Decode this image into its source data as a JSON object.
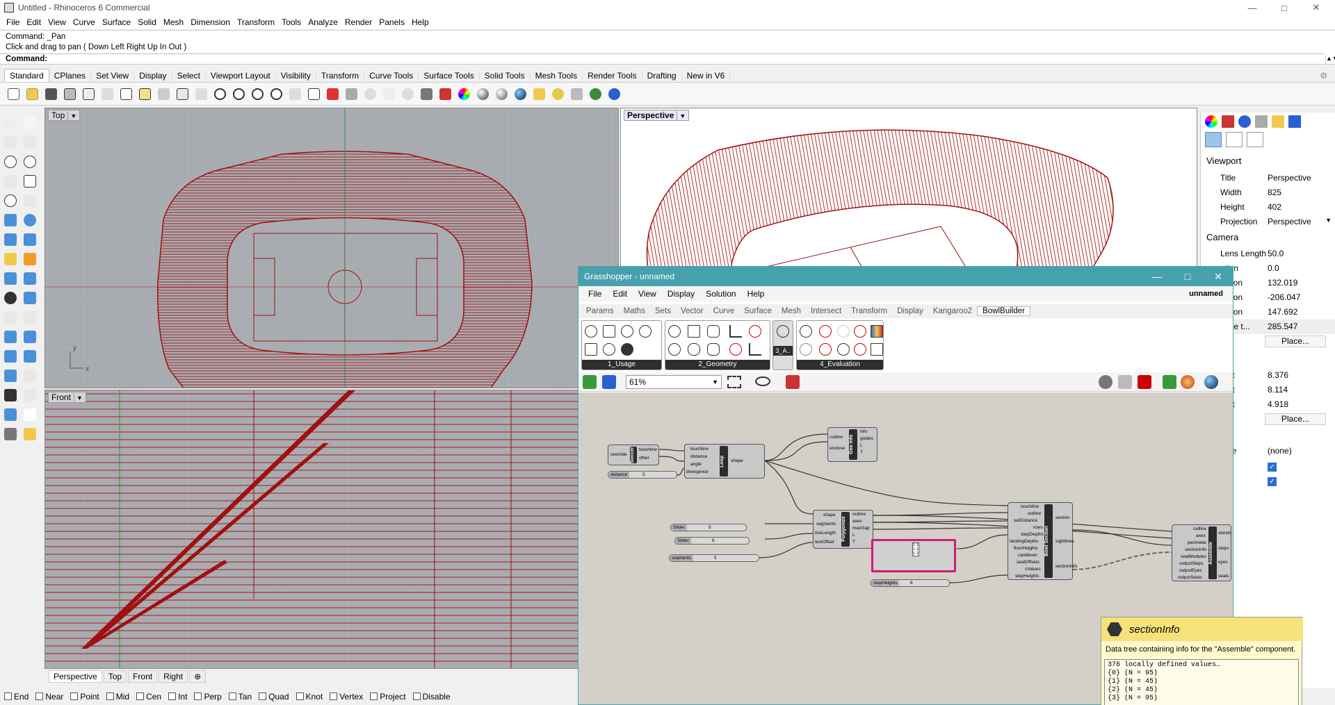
{
  "window": {
    "title": "Untitled - Rhinoceros 6 Commercial"
  },
  "menu": [
    "File",
    "Edit",
    "View",
    "Curve",
    "Surface",
    "Solid",
    "Mesh",
    "Dimension",
    "Transform",
    "Tools",
    "Analyze",
    "Render",
    "Panels",
    "Help"
  ],
  "command": {
    "line1": "Command: _Pan",
    "line2": "Click and drag to pan ( Down  Left  Right  Up  In  Out )",
    "prompt": "Command:"
  },
  "toolbar_tabs": [
    "Standard",
    "CPlanes",
    "Set View",
    "Display",
    "Select",
    "Viewport Layout",
    "Visibility",
    "Transform",
    "Curve Tools",
    "Surface Tools",
    "Solid Tools",
    "Mesh Tools",
    "Render Tools",
    "Drafting",
    "New in V6"
  ],
  "viewports": {
    "top": "Top",
    "perspective": "Perspective",
    "front": "Front"
  },
  "axis": {
    "y": "y",
    "x": "x"
  },
  "viewport_tabs": [
    "Perspective",
    "Top",
    "Front",
    "Right"
  ],
  "osnaps": [
    "End",
    "Near",
    "Point",
    "Mid",
    "Cen",
    "Int",
    "Perp",
    "Tan",
    "Quad",
    "Knot",
    "Vertex",
    "Project",
    "Disable"
  ],
  "properties": {
    "viewport_head": "Viewport",
    "rows": [
      {
        "k": "Title",
        "v": "Perspective"
      },
      {
        "k": "Width",
        "v": "825"
      },
      {
        "k": "Height",
        "v": "402"
      },
      {
        "k": "Projection",
        "v": "Perspective"
      }
    ],
    "camera_head": "Camera",
    "camera_rows": [
      {
        "k": "Lens Length",
        "v": "50.0"
      },
      {
        "k": "ation",
        "v": "0.0"
      },
      {
        "k": "cation",
        "v": "132.019"
      },
      {
        "k": "cation",
        "v": "-206.047"
      },
      {
        "k": "cation",
        "v": "147.692"
      },
      {
        "k": "ance t...",
        "v": "285.547"
      }
    ],
    "place1": "Place...",
    "target_rows": [
      {
        "k": "rget",
        "v": "8.376"
      },
      {
        "k": "rget",
        "v": "8.114"
      },
      {
        "k": "rget",
        "v": "4.918"
      }
    ],
    "place2": "Place...",
    "wallpaper_head": "per",
    "name_row": {
      "k": "ame",
      "v": "(none)"
    }
  },
  "grasshopper": {
    "title": "Grasshopper - unnamed",
    "menu": [
      "File",
      "Edit",
      "View",
      "Display",
      "Solution",
      "Help"
    ],
    "doc_name": "unnamed",
    "tabs": [
      "Params",
      "Maths",
      "Sets",
      "Vector",
      "Curve",
      "Surface",
      "Mesh",
      "Intersect",
      "Transform",
      "Display",
      "Kangaroo2",
      "BowlBuilder"
    ],
    "groups": [
      "1_Usage",
      "2_Geometry",
      "3_A..",
      "4_Evaluation"
    ],
    "zoom": "61%",
    "nodes": {
      "soccer": {
        "name": "Soccer",
        "in": [
          "override"
        ],
        "out": [
          "touchline",
          "other"
        ]
      },
      "loop": {
        "name": "Loop",
        "in": [
          "touchline",
          "distance",
          "angle",
          "divergence"
        ],
        "out": [
          "shape"
        ]
      },
      "geoinfo": {
        "name": "Geo Info",
        "in": [
          "outline",
          "enclose"
        ],
        "out": [
          "info",
          "guides",
          "L",
          "T"
        ]
      },
      "polygonize": {
        "name": "Polygonize",
        "in": [
          "shape",
          "segments",
          "lineLength",
          "textOffset"
        ],
        "out": [
          "outline",
          "axes",
          "maxGap",
          "L",
          "T"
        ]
      },
      "bowl": {
        "name": "Bowl Section",
        "in": [
          "touchline",
          "outline",
          "setDistance",
          "rows",
          "stepDepths",
          "landingDepths",
          "floorHeights",
          "cantilever",
          "seatOffsets",
          "cValues",
          "stepHeights"
        ],
        "out": [
          "section",
          "sightlines",
          "sectionInfo"
        ]
      },
      "assemble": {
        "name": "Assemble",
        "in": [
          "outline",
          "axes",
          "perimeter",
          "sectionInfo",
          "seatModules",
          "outputSteps",
          "outputEyes",
          "outputSeats"
        ],
        "out": [
          "stands",
          "steps",
          "eyes",
          "seats"
        ]
      }
    },
    "sliders": [
      {
        "label": "distance",
        "value": "5"
      },
      {
        "label": "Slider",
        "value": "5"
      },
      {
        "label": "Slider",
        "value": "6"
      },
      {
        "label": "segments",
        "value": "5"
      },
      {
        "label": "stepHeights",
        "value": "6"
      }
    ],
    "panel_values": [
      "1.1",
      "1.1",
      "1.1"
    ]
  },
  "tooltip": {
    "name": "sectionInfo",
    "desc": "Data tree containing info for the \"Assemble\" component.",
    "lines": [
      "376 locally defined values…",
      "{0} (N = 95)",
      "{1} (N = 45)",
      "{2} (N = 45)",
      "{3} (N = 95)"
    ]
  },
  "colors": {
    "wire": "#a01010",
    "gh_title": "#47a1ad",
    "viewport_bg": "#a9adb2",
    "tooltip_head": "#f7e27a",
    "selected_panel": "#d0187a"
  }
}
